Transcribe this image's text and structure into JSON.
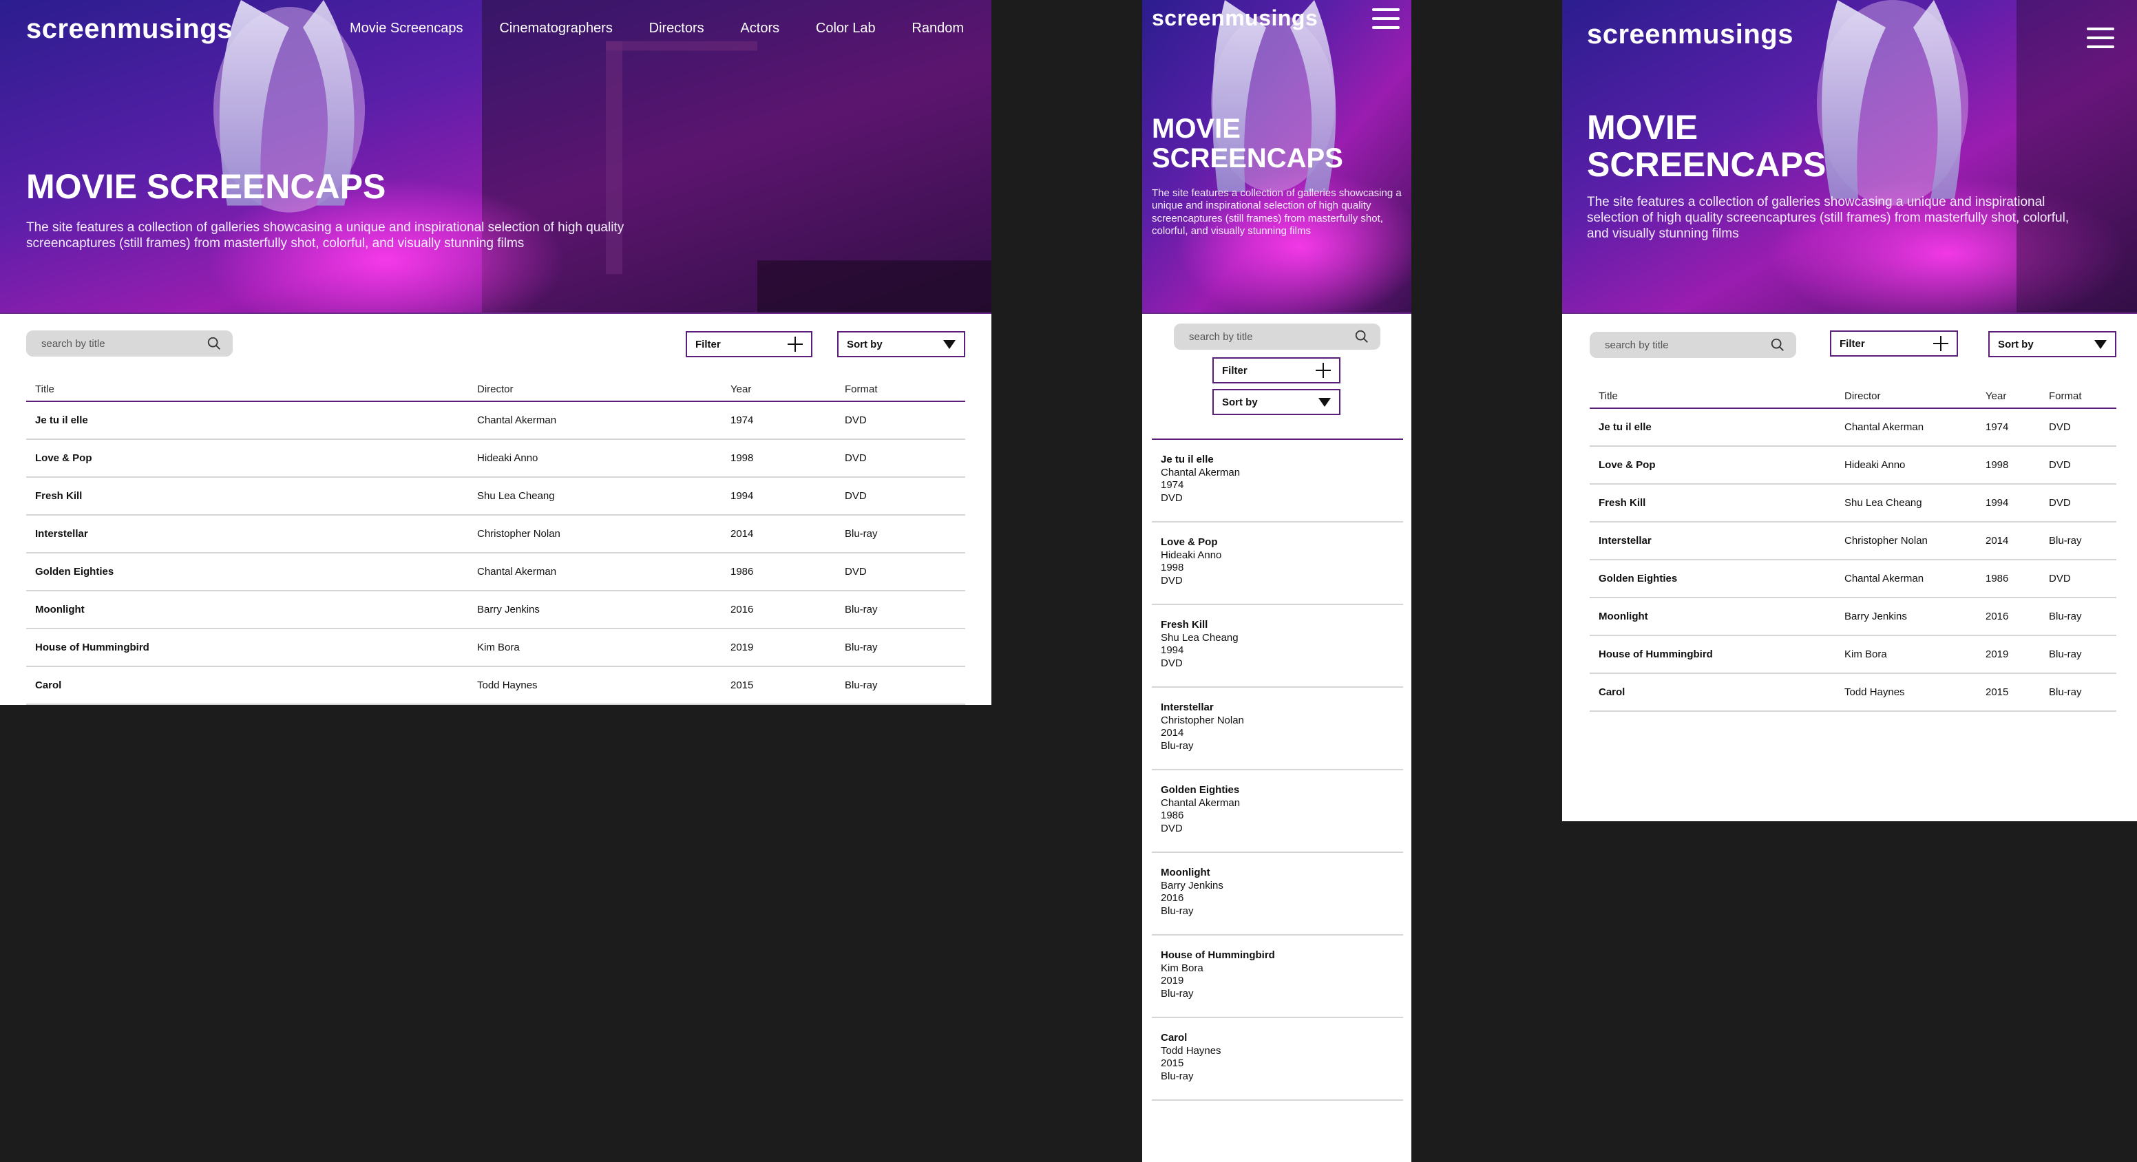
{
  "brand": "screenmusings",
  "nav": [
    "Movie Screencaps",
    "Cinematographers",
    "Directors",
    "Actors",
    "Color Lab",
    "Random"
  ],
  "hero": {
    "title": "MOVIE SCREENCAPS",
    "description": "The site features a collection of galleries showcasing a unique and inspirational selection of high quality screencaptures (still frames) from masterfully shot, colorful, and visually stunning films"
  },
  "search": {
    "placeholder": "search by title"
  },
  "controls": {
    "filter": "Filter",
    "sort": "Sort by"
  },
  "columns": [
    "Title",
    "Director",
    "Year",
    "Format"
  ],
  "movies": [
    {
      "title": "Je tu il elle",
      "director": "Chantal Akerman",
      "year": "1974",
      "format": "DVD"
    },
    {
      "title": "Love & Pop",
      "director": "Hideaki Anno",
      "year": "1998",
      "format": "DVD"
    },
    {
      "title": "Fresh Kill",
      "director": "Shu Lea Cheang",
      "year": "1994",
      "format": "DVD"
    },
    {
      "title": "Interstellar",
      "director": "Christopher Nolan",
      "year": "2014",
      "format": "Blu-ray"
    },
    {
      "title": "Golden Eighties",
      "director": "Chantal Akerman",
      "year": "1986",
      "format": "DVD"
    },
    {
      "title": "Moonlight",
      "director": "Barry Jenkins",
      "year": "2016",
      "format": "Blu-ray"
    },
    {
      "title": "House of Hummingbird",
      "director": "Kim Bora",
      "year": "2019",
      "format": "Blu-ray"
    },
    {
      "title": "Carol",
      "director": "Todd Haynes",
      "year": "2015",
      "format": "Blu-ray"
    }
  ],
  "colors": {
    "accent": "#5a1e7a",
    "hero_start": "#2a1a8a",
    "hero_end": "#b01ab0",
    "page_bg": "#1c1c1c"
  }
}
